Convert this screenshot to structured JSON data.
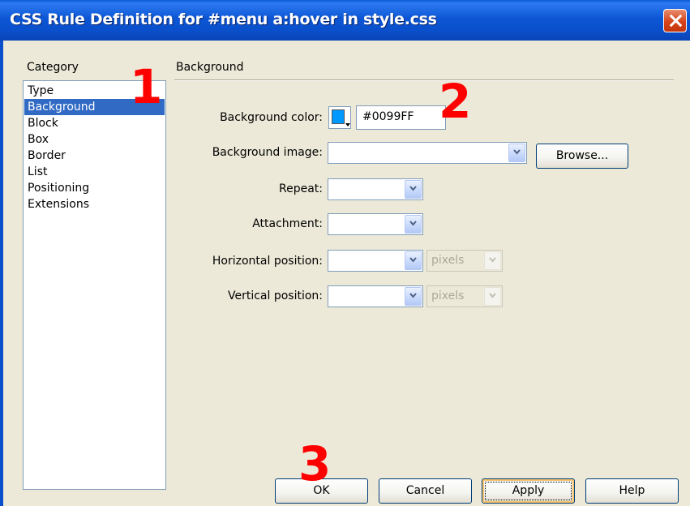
{
  "window": {
    "title": "CSS Rule Definition for #menu a:hover in style.css"
  },
  "category": {
    "heading": "Category",
    "items": [
      "Type",
      "Background",
      "Block",
      "Box",
      "Border",
      "List",
      "Positioning",
      "Extensions"
    ],
    "selected": "Background"
  },
  "panel": {
    "heading": "Background",
    "fields": {
      "bg_color_label": "Background color:",
      "bg_color_value": "#0099FF",
      "bg_color_swatch": "#0099FF",
      "bg_image_label": "Background image:",
      "bg_image_value": "",
      "browse_label": "Browse...",
      "repeat_label": "Repeat:",
      "repeat_value": "",
      "attachment_label": "Attachment:",
      "attachment_value": "",
      "hpos_label": "Horizontal position:",
      "hpos_value": "",
      "hpos_unit": "pixels",
      "vpos_label": "Vertical position:",
      "vpos_value": "",
      "vpos_unit": "pixels"
    }
  },
  "buttons": {
    "ok": "OK",
    "cancel": "Cancel",
    "apply": "Apply",
    "help": "Help"
  },
  "annotations": [
    "1",
    "2",
    "3"
  ],
  "icons": {
    "close": "close-icon",
    "color_picker": "color-swatch-icon",
    "dropdown": "chevron-down-icon"
  },
  "colors": {
    "titlebar": "#0A4FCB",
    "selection": "#316AC5",
    "annotation": "#FF0000",
    "dialog_bg": "#ECE9D8"
  }
}
